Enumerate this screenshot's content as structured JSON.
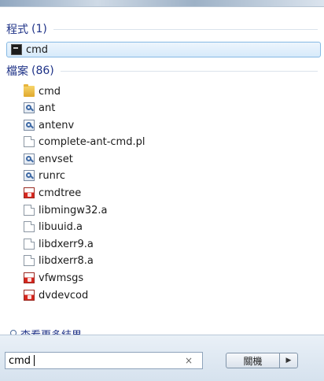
{
  "programs": {
    "header": "程式",
    "count": "(1)",
    "items": [
      {
        "label": "cmd",
        "icon": "cmd-icon"
      }
    ]
  },
  "files": {
    "header": "檔案",
    "count": "(86)",
    "items": [
      {
        "label": "cmd",
        "icon": "folder-icon"
      },
      {
        "label": "ant",
        "icon": "script-icon"
      },
      {
        "label": "antenv",
        "icon": "script-icon"
      },
      {
        "label": "complete-ant-cmd.pl",
        "icon": "file-icon"
      },
      {
        "label": "envset",
        "icon": "script-icon"
      },
      {
        "label": "runrc",
        "icon": "script-icon"
      },
      {
        "label": "cmdtree",
        "icon": "exe-icon"
      },
      {
        "label": "libmingw32.a",
        "icon": "file-icon"
      },
      {
        "label": "libuuid.a",
        "icon": "file-icon"
      },
      {
        "label": "libdxerr9.a",
        "icon": "file-icon"
      },
      {
        "label": "libdxerr8.a",
        "icon": "file-icon"
      },
      {
        "label": "vfwmsgs",
        "icon": "exe-icon"
      },
      {
        "label": "dvdevcod",
        "icon": "exe-icon"
      }
    ]
  },
  "see_more": "查看更多結果",
  "search": {
    "value": "cmd",
    "clear_symbol": "×"
  },
  "shutdown": {
    "label": "關機",
    "arrow": "▶"
  }
}
